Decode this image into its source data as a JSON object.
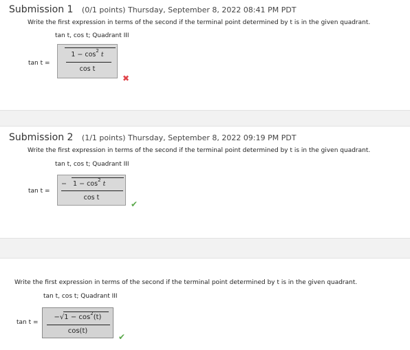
{
  "submission1": {
    "label": "Submission 1",
    "meta": "(0/1 points)  Thursday, September 8, 2022 08:41 PM PDT",
    "question": "Write the first expression in terms of the second if the terminal point determined by t is in the given quadrant.",
    "given": "tan t, cos t;  Quadrant III",
    "lhs": "tan t =",
    "numerator": "1 − cos",
    "numerator_var": "t",
    "exponent": "2",
    "denominator": "cos  t",
    "status_mark": "✖"
  },
  "submission2": {
    "label": "Submission 2",
    "meta": "(1/1 points)  Thursday, September 8, 2022 09:19 PM PDT",
    "question": "Write the first expression in terms of the second if the terminal point determined by t is in the given quadrant.",
    "given": "tan t, cos t;  Quadrant III",
    "lhs": "tan t =",
    "sign": "−",
    "numerator": "1 − cos",
    "numerator_var": "t",
    "exponent": "2",
    "denominator": "cos  t",
    "status_mark": "✔"
  },
  "final": {
    "question": "Write the first expression in terms of the second if the terminal point determined by t is in the given quadrant.",
    "given": "tan t, cos t;  Quadrant III",
    "lhs": "tan t =",
    "numerator": "−√1 − cos",
    "numerator_tail": "(t)",
    "exponent": "2",
    "denominator": "cos(t)",
    "status_mark": "✔"
  },
  "colors": {
    "wrong": "#e0444a",
    "correct": "#5aa84a",
    "answer_bg": "#d9d9d9"
  }
}
